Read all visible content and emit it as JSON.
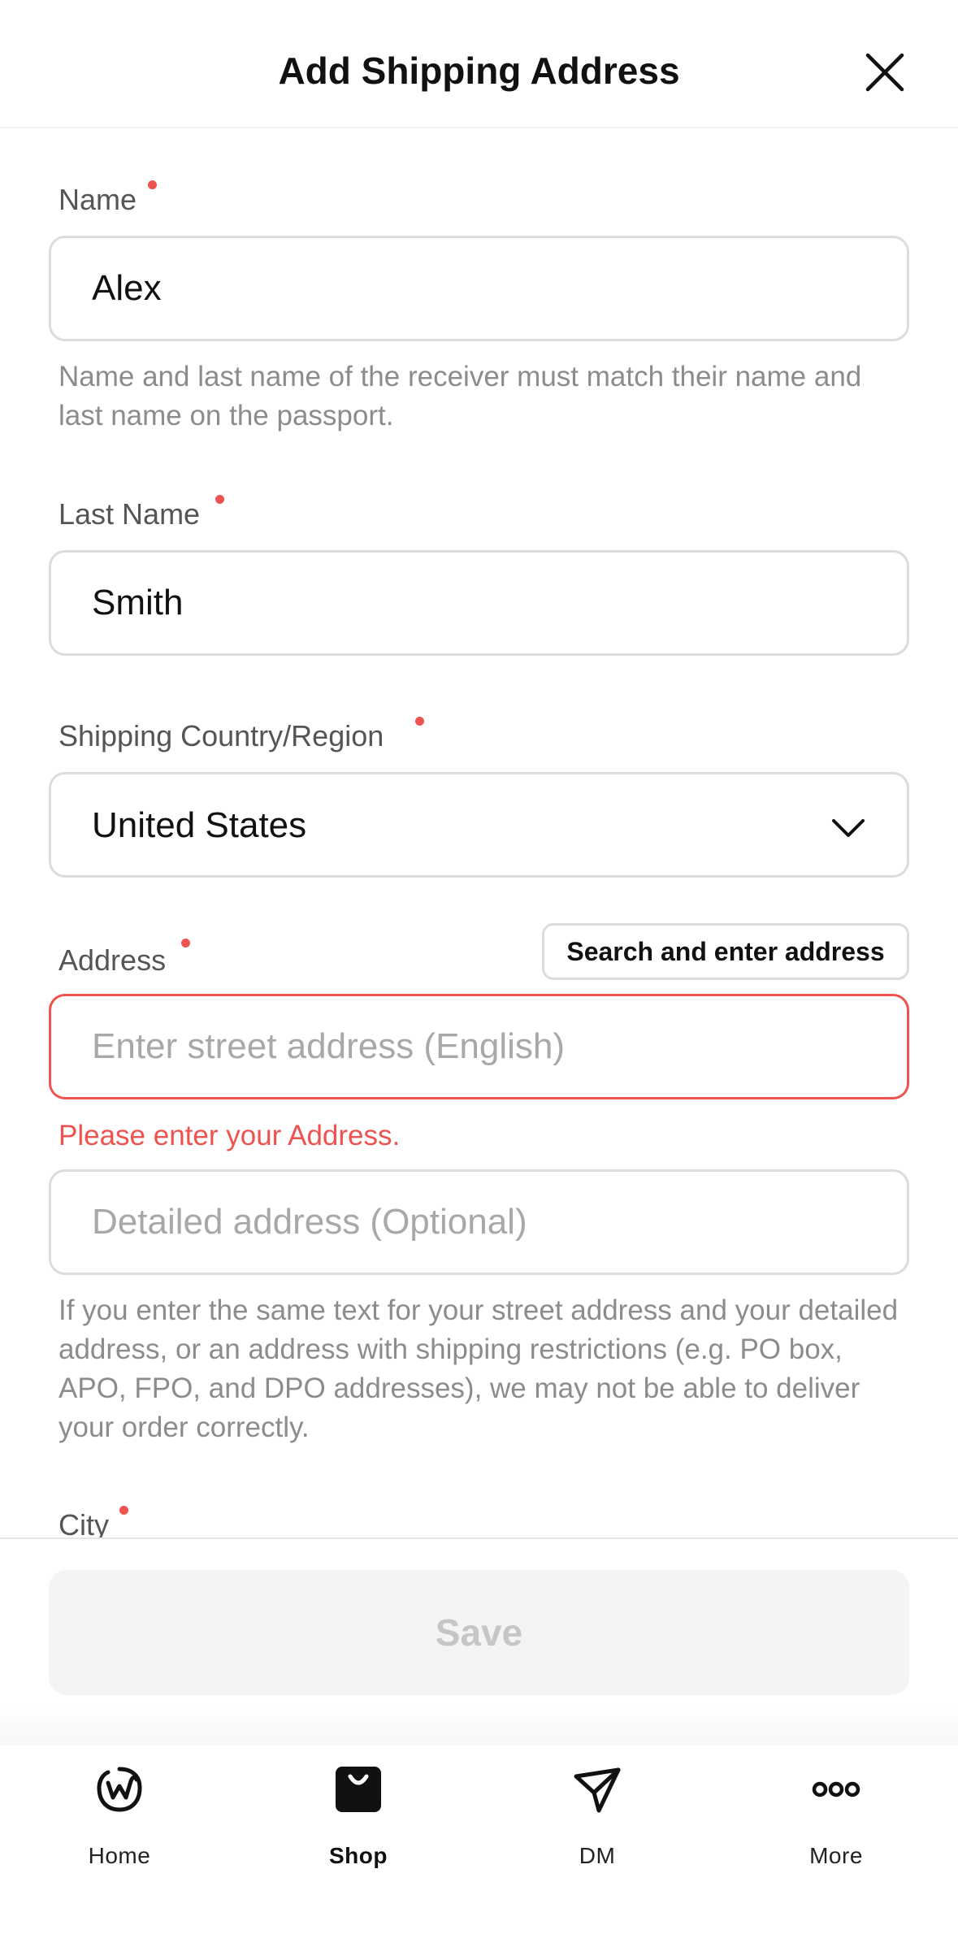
{
  "header": {
    "title": "Add Shipping Address"
  },
  "form": {
    "name": {
      "label": "Name",
      "value": "Alex",
      "helper": "Name and last name of the receiver must match their name and last name on the passport."
    },
    "last_name": {
      "label": "Last Name",
      "value": "Smith"
    },
    "country": {
      "label": "Shipping Country/Region",
      "value": "United States"
    },
    "address": {
      "label": "Address",
      "search_button": "Search and enter address",
      "street_placeholder": "Enter street address (English)",
      "street_value": "",
      "error": "Please enter your Address.",
      "detail_placeholder": "Detailed address (Optional)",
      "detail_value": "",
      "helper": "If you enter the same text for your street address and your detailed address, or an address with shipping restrictions (e.g. PO box, APO, FPO, and DPO addresses), we may not be able to deliver your order correctly."
    },
    "city": {
      "label": "City"
    }
  },
  "save": {
    "label": "Save"
  },
  "nav": {
    "items": [
      {
        "label": "Home",
        "icon": "home-w-icon",
        "active": false
      },
      {
        "label": "Shop",
        "icon": "shop-bag-icon",
        "active": true
      },
      {
        "label": "DM",
        "icon": "paper-plane-icon",
        "active": false
      },
      {
        "label": "More",
        "icon": "more-dots-icon",
        "active": false
      }
    ]
  },
  "colors": {
    "required": "#ef5350",
    "error": "#ef5350",
    "border": "#dcdcdc",
    "disabled_bg": "#f4f4f4",
    "disabled_text": "#c6c6c6"
  }
}
